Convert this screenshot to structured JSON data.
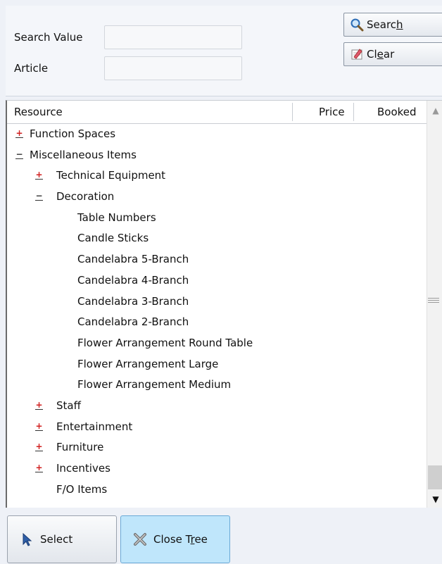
{
  "search": {
    "search_value_label": "Search Value",
    "article_label": "Article",
    "search_value": "",
    "article_value": "",
    "search_button_pre": "Searc",
    "search_button_accel": "h",
    "clear_button_pre": "Cl",
    "clear_button_accel": "e",
    "clear_button_post": "ar"
  },
  "grid": {
    "columns": [
      "Resource",
      "Price",
      "Booked"
    ],
    "rows": [
      {
        "label": "Function Spaces",
        "level": 0,
        "expander": "plus"
      },
      {
        "label": "Miscellaneous Items",
        "level": 0,
        "expander": "minus"
      },
      {
        "label": "Technical Equipment",
        "level": 1,
        "expander": "plus"
      },
      {
        "label": "Decoration",
        "level": 1,
        "expander": "minus"
      },
      {
        "label": "Table Numbers",
        "level": 2,
        "expander": "none"
      },
      {
        "label": "Candle Sticks",
        "level": 2,
        "expander": "none"
      },
      {
        "label": "Candelabra 5-Branch",
        "level": 2,
        "expander": "none"
      },
      {
        "label": "Candelabra 4-Branch",
        "level": 2,
        "expander": "none"
      },
      {
        "label": "Candelabra 3-Branch",
        "level": 2,
        "expander": "none"
      },
      {
        "label": "Candelabra 2-Branch",
        "level": 2,
        "expander": "none"
      },
      {
        "label": "Flower Arrangement Round Table",
        "level": 2,
        "expander": "none"
      },
      {
        "label": "Flower Arrangement Large",
        "level": 2,
        "expander": "none"
      },
      {
        "label": "Flower Arrangement Medium",
        "level": 2,
        "expander": "none"
      },
      {
        "label": "Staff",
        "level": 1,
        "expander": "plus"
      },
      {
        "label": "Entertainment",
        "level": 1,
        "expander": "plus"
      },
      {
        "label": "Furniture",
        "level": 1,
        "expander": "plus"
      },
      {
        "label": "Incentives",
        "level": 1,
        "expander": "plus"
      },
      {
        "label": "F/O Items",
        "level": 1,
        "expander": "none"
      }
    ]
  },
  "footer": {
    "select_label": "Select",
    "close_tree_pre": "Close T",
    "close_tree_accel": "r",
    "close_tree_post": "ee"
  },
  "colors": {
    "plus_expander": "#d11f1f",
    "close_tree_bg": "#bfe6fb",
    "panel_bg": "#f4f6fa"
  },
  "icons": {
    "search": "magnifier-icon",
    "clear": "eraser-icon",
    "select": "cursor-arrow-icon",
    "close_tree": "collapse-x-icon"
  }
}
